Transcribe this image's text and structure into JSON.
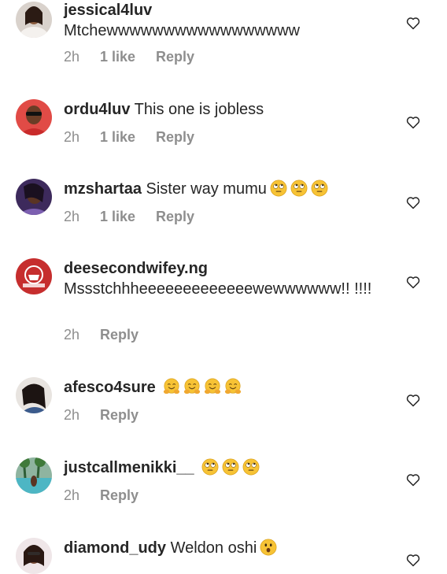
{
  "comments": [
    {
      "username": "jessical4luv",
      "text": "Mtchewwwwwwwwwwwwwwwww",
      "time": "2h",
      "likes": "1 like",
      "reply": "Reply",
      "emojis": []
    },
    {
      "username": "ordu4luv",
      "text": "This one is jobless",
      "time": "2h",
      "likes": "1 like",
      "reply": "Reply",
      "emojis": []
    },
    {
      "username": "mzshartaa",
      "text": "Sister way mumu",
      "time": "2h",
      "likes": "1 like",
      "reply": "Reply",
      "emojis": [
        "rolling-eyes",
        "rolling-eyes",
        "rolling-eyes"
      ]
    },
    {
      "username": "deesecondwifey.ng",
      "text": "Mssstchhheeeeeeeeeeeeewewwwwww!! !!!!",
      "time": "2h",
      "likes": "",
      "reply": "Reply",
      "emojis": []
    },
    {
      "username": "afesco4sure",
      "text": "",
      "time": "2h",
      "likes": "",
      "reply": "Reply",
      "emojis": [
        "hugging",
        "hugging",
        "hugging",
        "hugging"
      ]
    },
    {
      "username": "justcallmenikki__",
      "text": "",
      "time": "2h",
      "likes": "",
      "reply": "Reply",
      "emojis": [
        "rolling-eyes",
        "rolling-eyes",
        "rolling-eyes"
      ]
    },
    {
      "username": "diamond_udy",
      "text": "Weldon oshi",
      "time": "",
      "likes": "",
      "reply": "",
      "emojis": [
        "astonished"
      ]
    }
  ],
  "colors": {
    "text": "#262626",
    "secondary": "#8e8e8e",
    "emoji_yellow": "#f7c335"
  }
}
